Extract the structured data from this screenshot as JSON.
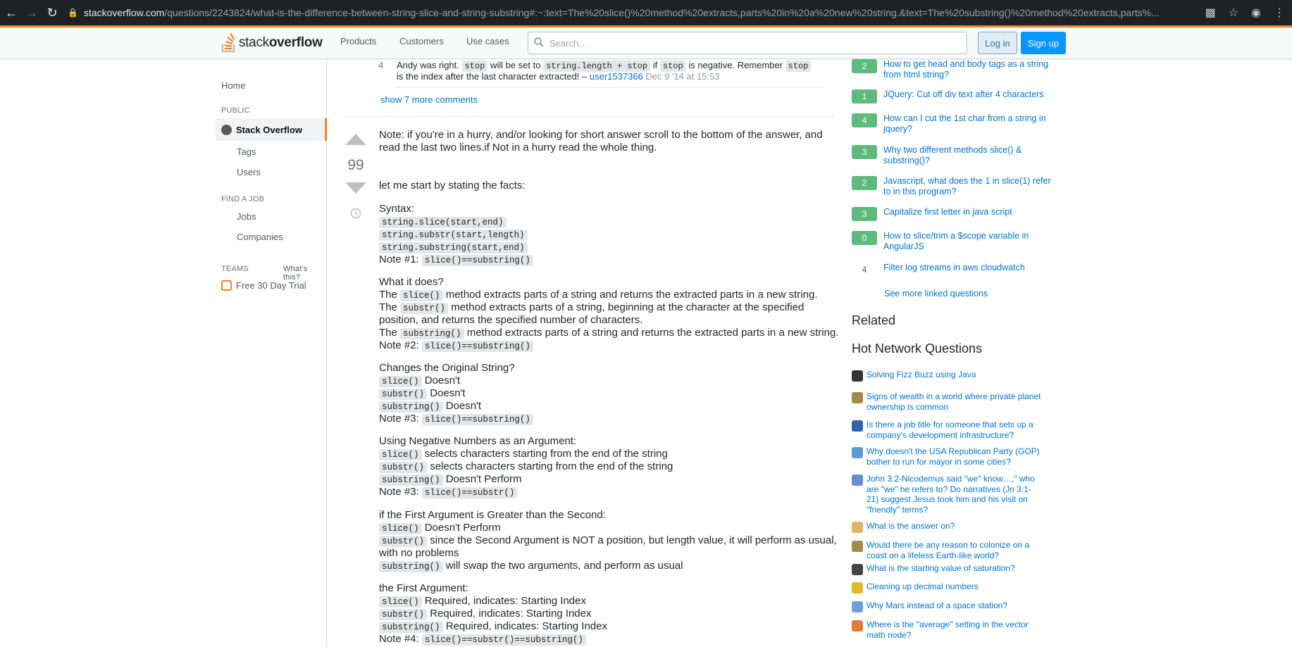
{
  "browser": {
    "url_host": "stackoverflow.com",
    "url_path": "/questions/2243824/what-is-the-difference-between-string-slice-and-string-substring#:~:text=The%20slice()%20method%20extracts,parts%20in%20a%20new%20string.&text=The%20substring()%20method%20extracts,parts%..."
  },
  "header": {
    "logo_plain": "stack",
    "logo_bold": "overflow",
    "nav": [
      "Products",
      "Customers",
      "Use cases"
    ],
    "search_placeholder": "Search…",
    "login": "Log in",
    "signup": "Sign up"
  },
  "sidebar": {
    "home": "Home",
    "public": "PUBLIC",
    "stackoverflow": "Stack Overflow",
    "tags": "Tags",
    "users": "Users",
    "find_job": "FIND A JOB",
    "jobs": "Jobs",
    "companies": "Companies",
    "teams": "TEAMS",
    "whats_this": "What's this?",
    "trial": "Free 30 Day Trial"
  },
  "comment": {
    "score": "4",
    "t1": "Andy was right.",
    "c1": "stop",
    "t2": "will be set to",
    "c2": "string.length + stop",
    "t3": "if",
    "c3": "stop",
    "t4": "is negative. Remember",
    "c4": "stop",
    "t5": "is the index after the last character extracted! –",
    "user": "user1537366",
    "date": "Dec 9 '14 at 15:53",
    "show_more": "show 7 more comments"
  },
  "answer": {
    "votes": "99",
    "note_line1": "Note: if you're in a hurry, and/or looking for short answer scroll to the bottom of the answer, and",
    "note_line2": "read the last two lines.if Not in a hurry read the whole thing.",
    "facts": "let me start by stating the facts:",
    "syntax": "Syntax:",
    "syn1": "string.slice(start,end)",
    "syn2": "string.substr(start,length)",
    "syn3": "string.substring(start,end)",
    "note1_label": "Note #1:",
    "note1_code": "slice()==substring()",
    "what": "What it does?",
    "w1_pre": "The",
    "w1_code": "slice()",
    "w1_post": "method extracts parts of a string and returns the extracted parts in a new string.",
    "w2_pre": "The",
    "w2_code": "substr()",
    "w2_post": "method extracts parts of a string, beginning at the character at the specified",
    "w2_line2": "position, and returns the specified number of characters.",
    "w3_pre": "The",
    "w3_code": "substring()",
    "w3_post": "method extracts parts of a string and returns the extracted parts in a new string.",
    "note2_label": "Note #2:",
    "note2_code": "slice()==substring()",
    "changes": "Changes the Original String?",
    "ch1_code": "slice()",
    "ch1_text": "Doesn't",
    "ch2_code": "substr()",
    "ch2_text": "Doesn't",
    "ch3_code": "substring()",
    "ch3_text": "Doesn't",
    "note3a_label": "Note #3:",
    "note3a_code": "slice()==substring()",
    "neg": "Using Negative Numbers as an Argument:",
    "n1_code": "slice()",
    "n1_text": "selects characters starting from the end of the string",
    "n2_code": "substr()",
    "n2_text": "selects characters starting from the end of the string",
    "n3_code": "substring()",
    "n3_text": "Doesn't Perform",
    "note3b_label": "Note #3:",
    "note3b_code": "slice()==substr()",
    "greater": "if the First Argument is Greater than the Second:",
    "g1_code": "slice()",
    "g1_text": "Doesn't Perform",
    "g2_code": "substr()",
    "g2_text": "since the Second Argument is NOT a position, but length value, it will perform as usual,",
    "g2_line2": "with no problems",
    "g3_code": "substring()",
    "g3_text": "will swap the two arguments, and perform as usual",
    "first": "the First Argument:",
    "f1_code": "slice()",
    "f1_text": "Required, indicates: Starting Index",
    "f2_code": "substr()",
    "f2_text": "Required, indicates: Starting Index",
    "f3_code": "substring()",
    "f3_text": "Required, indicates: Starting Index",
    "note4_label": "Note #4:",
    "note4_code": "slice()==substr()==substring()"
  },
  "linked": [
    {
      "score": "2",
      "title": "How to get head and body tags as a string from html string?",
      "accent": "#5eba7d"
    },
    {
      "score": "1",
      "title": "JQuery: Cut off div text after 4 characters",
      "accent": "#5eba7d"
    },
    {
      "score": "4",
      "title": "How can I cut the 1st char from a string in jquery?",
      "accent": "#5eba7d"
    },
    {
      "score": "3",
      "title": "Why two different methods slice() & substring()?",
      "accent": "#5eba7d"
    },
    {
      "score": "2",
      "title": "Javascript, what does the 1 in slice(1) refer to in this program?",
      "accent": "#5eba7d"
    },
    {
      "score": "3",
      "title": "Capitalize first letter in java script",
      "accent": "#5eba7d"
    },
    {
      "score": "0",
      "title": "How to slice/trim a $scope variable in AngularJS",
      "accent": "#5eba7d"
    },
    {
      "score": "4",
      "title": "Filter log streams in aws cloudwatch",
      "accent": "none"
    }
  ],
  "see_more": "See more linked questions",
  "related": "Related",
  "hot_title": "Hot Network Questions",
  "hot": [
    {
      "title": "Solving Fizz Buzz using Java",
      "icon": "codereview-icon",
      "color": "#333333"
    },
    {
      "title": "Signs of wealth in a world where private planet ownership is common",
      "icon": "worldbuilding-icon",
      "color": "#a18a4a"
    },
    {
      "title": "Is there a job title for someone that sets up a company's development infrastructure?",
      "icon": "workplace-icon",
      "color": "#2e64a8"
    },
    {
      "title": "Why doesn't the USA Republican Party (GOP) bother to run for mayor in some cities?",
      "icon": "politics-icon",
      "color": "#5c9bd6"
    },
    {
      "title": "John 3:2-Nicodemus said \"we\" know…,\" who are \"we\" he refers to? Do narratives (Jn 3:1-21) suggest Jesus took him and his visit on \"friendly\" terms?",
      "icon": "hermeneutics-icon",
      "color": "#6a8fd0"
    },
    {
      "title": "What is the answer on?",
      "icon": "puzzling-icon",
      "color": "#e3b36a"
    },
    {
      "title": "Would there be any reason to colonize on a coast on a lifeless Earth-like world?",
      "icon": "worldbuilding-icon",
      "color": "#a18a4a"
    },
    {
      "title": "What is the starting value of saturation?",
      "icon": "chess-icon",
      "color": "#444444"
    },
    {
      "title": "Cleaning up decimal numbers",
      "icon": "codegolf-icon",
      "color": "#e5b82c"
    },
    {
      "title": "Why Mars instead of a space station?",
      "icon": "space-icon",
      "color": "#6aa2d8"
    },
    {
      "title": "Where is the \"average\" setting in the vector math node?",
      "icon": "blender-icon",
      "color": "#e07b39"
    }
  ]
}
